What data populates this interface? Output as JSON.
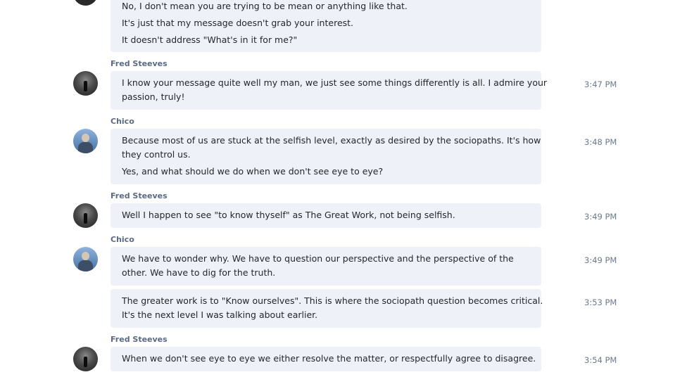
{
  "messages": [
    {
      "lines": [
        "No, I don't mean you are trying to be mean or anything like that.",
        "It's just that my message doesn't grab your interest.",
        "It doesn't address \"What's in it for me?\""
      ]
    },
    {
      "author": "Fred Steeves",
      "time": "3:47 PM",
      "lines": [
        "I know your message quite well my man, we just see some things differently is all. I admire your",
        "passion, truly!"
      ]
    },
    {
      "author": "Chico",
      "time": "3:48 PM",
      "lines": [
        "Because most of us are stuck at the selfish level, exactly as desired by the sociopaths.  It's how",
        "they control us.",
        "Yes, and what should we do when we don't see eye to eye?"
      ]
    },
    {
      "author": "Fred Steeves",
      "time": "3:49 PM",
      "lines": [
        "Well I happen to see \"to know thyself\" as The Great Work, not being selfish."
      ]
    },
    {
      "author": "Chico",
      "time": "3:49 PM",
      "lines": [
        "We have to wonder why.  We have to question our perspective and the perspective of the",
        "other.  We have to dig for the truth."
      ]
    },
    {
      "time": "3:53 PM",
      "lines": [
        "The greater work is to \"Know ourselves\".  This is where the sociopath question becomes critical.",
        "It's the next level I was talking about earlier."
      ]
    },
    {
      "author": "Fred Steeves",
      "time": "3:54 PM",
      "lines": [
        "When we don't see eye to eye we either resolve the matter, or respectfully agree to disagree."
      ]
    }
  ]
}
